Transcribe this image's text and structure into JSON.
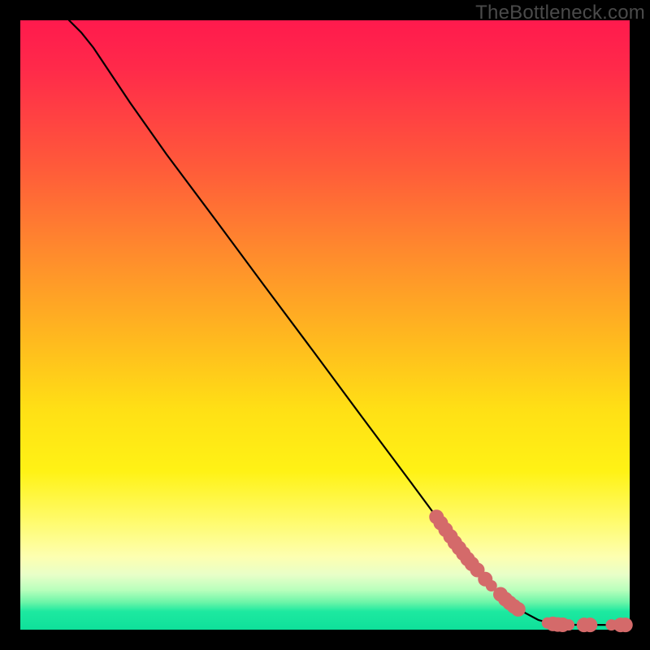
{
  "watermark": "TheBottleneck.com",
  "chart_data": {
    "type": "line",
    "title": "",
    "xlabel": "",
    "ylabel": "",
    "xlim": [
      0,
      100
    ],
    "ylim": [
      0,
      100
    ],
    "grid": false,
    "legend": false,
    "series": [
      {
        "name": "curve",
        "type": "line",
        "color": "#000000",
        "x": [
          8,
          10,
          12,
          14,
          18,
          24,
          32,
          40,
          48,
          56,
          64,
          72,
          78,
          82,
          85,
          87,
          89,
          91,
          93,
          95,
          97,
          100
        ],
        "y": [
          100,
          98,
          95.5,
          92.5,
          86.5,
          78,
          67.3,
          56.5,
          45.8,
          35,
          24.3,
          13.5,
          6.5,
          3.2,
          1.6,
          1.05,
          0.85,
          0.8,
          0.78,
          0.78,
          0.78,
          0.78
        ]
      },
      {
        "name": "points",
        "type": "scatter",
        "color": "#d46a6a",
        "points": [
          {
            "x": 68.3,
            "y": 18.5,
            "r": 9
          },
          {
            "x": 69.0,
            "y": 17.5,
            "r": 9
          },
          {
            "x": 69.8,
            "y": 16.4,
            "r": 9
          },
          {
            "x": 70.6,
            "y": 15.3,
            "r": 9
          },
          {
            "x": 71.3,
            "y": 14.3,
            "r": 9
          },
          {
            "x": 72.0,
            "y": 13.4,
            "r": 9
          },
          {
            "x": 72.7,
            "y": 12.5,
            "r": 9
          },
          {
            "x": 73.4,
            "y": 11.6,
            "r": 9
          },
          {
            "x": 74.1,
            "y": 10.8,
            "r": 9
          },
          {
            "x": 75.0,
            "y": 9.8,
            "r": 9
          },
          {
            "x": 76.3,
            "y": 8.3,
            "r": 9
          },
          {
            "x": 77.3,
            "y": 7.2,
            "r": 7
          },
          {
            "x": 78.8,
            "y": 5.8,
            "r": 9
          },
          {
            "x": 79.6,
            "y": 5.0,
            "r": 9
          },
          {
            "x": 80.3,
            "y": 4.4,
            "r": 9
          },
          {
            "x": 81.0,
            "y": 3.85,
            "r": 9
          },
          {
            "x": 81.7,
            "y": 3.35,
            "r": 9
          },
          {
            "x": 86.5,
            "y": 1.1,
            "r": 7
          },
          {
            "x": 87.4,
            "y": 0.95,
            "r": 9
          },
          {
            "x": 88.2,
            "y": 0.85,
            "r": 9
          },
          {
            "x": 89.0,
            "y": 0.8,
            "r": 9
          },
          {
            "x": 90.0,
            "y": 0.78,
            "r": 7
          },
          {
            "x": 92.5,
            "y": 0.78,
            "r": 9
          },
          {
            "x": 93.5,
            "y": 0.78,
            "r": 9
          },
          {
            "x": 97.0,
            "y": 0.78,
            "r": 7
          },
          {
            "x": 98.5,
            "y": 0.78,
            "r": 9
          },
          {
            "x": 99.3,
            "y": 0.78,
            "r": 9
          }
        ]
      }
    ]
  }
}
